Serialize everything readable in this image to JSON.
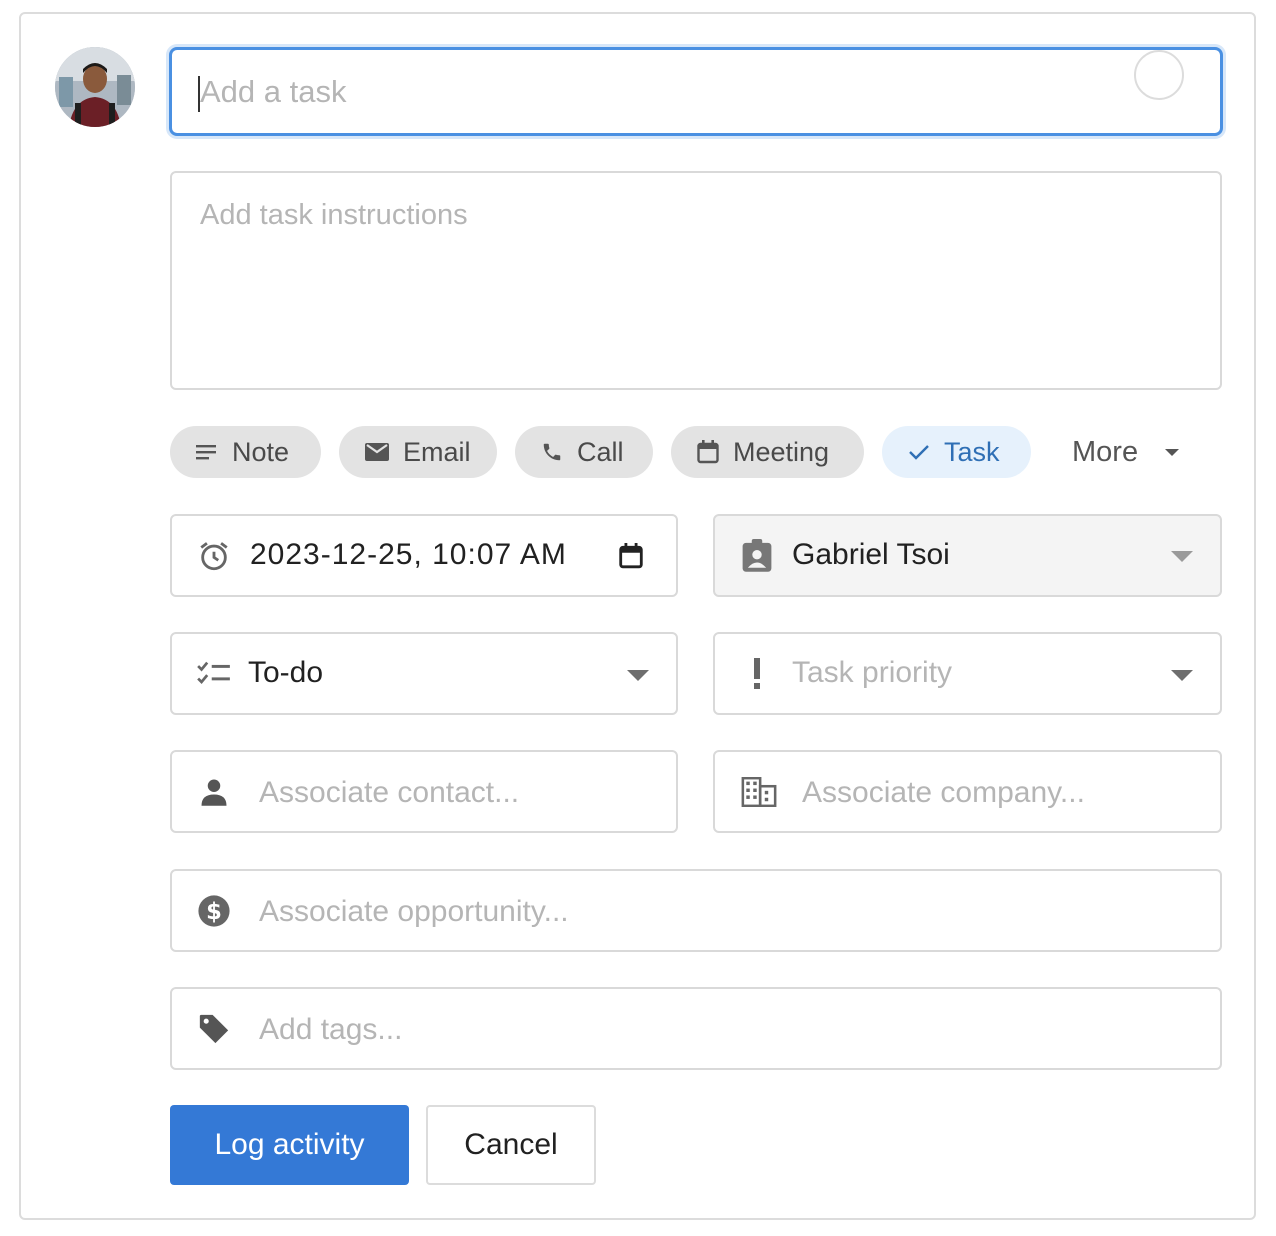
{
  "task": {
    "title_placeholder": "Add a task",
    "instructions_placeholder": "Add task instructions"
  },
  "activity_types": [
    {
      "label": "Note",
      "icon": "note-lines-icon",
      "active": false
    },
    {
      "label": "Email",
      "icon": "envelope-icon",
      "active": false
    },
    {
      "label": "Call",
      "icon": "phone-icon",
      "active": false
    },
    {
      "label": "Meeting",
      "icon": "calendar-icon",
      "active": false
    },
    {
      "label": "Task",
      "icon": "checkmark-icon",
      "active": true
    }
  ],
  "more_label": "More",
  "due_date": {
    "value": "2023-12-25, 10:07 AM",
    "icon": "alarm-clock-icon"
  },
  "assignee": {
    "value": "Gabriel Tsoi",
    "icon": "contact-badge-icon"
  },
  "status": {
    "value": "To-do",
    "icon": "checklist-icon"
  },
  "priority": {
    "placeholder": "Task priority",
    "icon": "exclamation-icon"
  },
  "contact": {
    "placeholder": "Associate contact...",
    "icon": "person-icon"
  },
  "company": {
    "placeholder": "Associate company...",
    "icon": "building-icon"
  },
  "opportunity": {
    "placeholder": "Associate opportunity...",
    "icon": "dollar-circle-icon"
  },
  "tags": {
    "placeholder": "Add tags...",
    "icon": "tag-icon"
  },
  "actions": {
    "submit_label": "Log activity",
    "cancel_label": "Cancel"
  },
  "colors": {
    "primary": "#3479d6",
    "focus_border": "#4a90e2",
    "active_chip_bg": "#e6f1fc",
    "active_chip_text": "#2f6fb5"
  }
}
